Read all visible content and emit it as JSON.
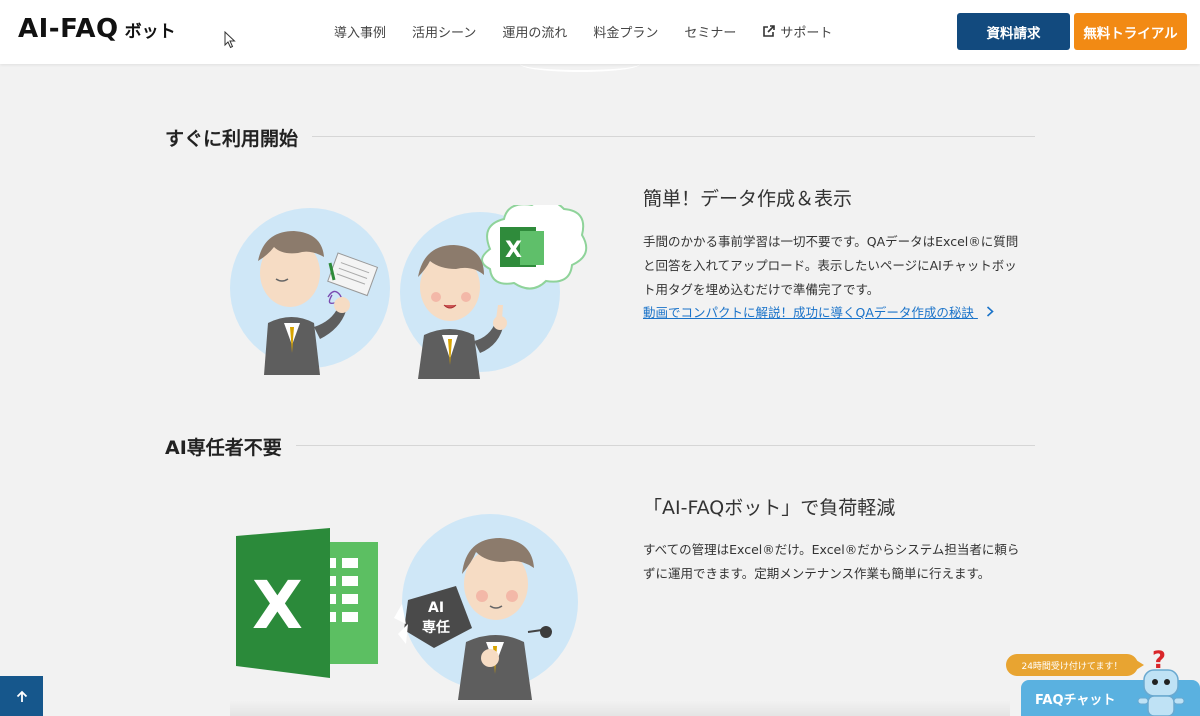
{
  "header": {
    "logo_main": "AI-FAQ",
    "logo_sub": "ボット",
    "nav": [
      {
        "label": "導入事例"
      },
      {
        "label": "活用シーン"
      },
      {
        "label": "運用の流れ"
      },
      {
        "label": "料金プラン"
      },
      {
        "label": "セミナー"
      },
      {
        "label": "サポート",
        "icon": "external-link-icon"
      }
    ],
    "btn_document": "資料請求",
    "btn_trial": "無料トライアル",
    "colors": {
      "primary": "#124a7e",
      "accent": "#f28a14"
    }
  },
  "sections": [
    {
      "heading": "すぐに利用開始",
      "title": "簡単！データ作成＆表示",
      "body_lines": [
        "手間のかかる事前学習は一切不要です。QAデータはExcel®に質問",
        "と回答を入れてアップロード。表示したいページにAIチャットボッ",
        "ト用タグを埋め込むだけで準備完了です。"
      ],
      "link": "動画でコンパクトに解説！成功に導くQAデータ作成の秘訣"
    },
    {
      "heading": "AI専任者不要",
      "title": "「AI-FAQボット」で負荷軽減",
      "body_lines": [
        "すべての管理はExcel®だけ。Excel®だからシステム担当者に頼ら",
        "ずに運用できます。定期メンテナンス作業も簡単に行えます。"
      ],
      "badge_lines": [
        "AI",
        "専任"
      ]
    }
  ],
  "widgets": {
    "bubble": "24時間受け付けてます！",
    "faq_chat": "FAQチャット",
    "to_top_icon": "arrow-up-icon"
  }
}
